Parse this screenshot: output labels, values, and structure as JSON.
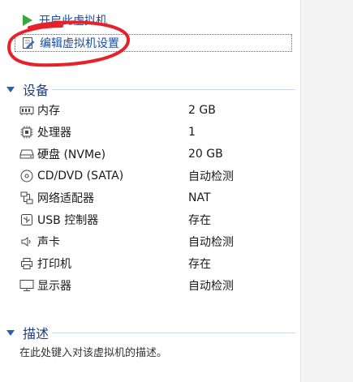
{
  "actions": {
    "power_on": "开启此虚拟机",
    "edit_settings": "编辑虚拟机设置"
  },
  "devices_section": {
    "title": "设备",
    "items": [
      {
        "name": "内存",
        "value": "2 GB",
        "icon": "memory-icon"
      },
      {
        "name": "处理器",
        "value": "1",
        "icon": "processor-icon"
      },
      {
        "name": "硬盘 (NVMe)",
        "value": "20 GB",
        "icon": "hard-disk-icon"
      },
      {
        "name": "CD/DVD (SATA)",
        "value": "自动检测",
        "icon": "cd-dvd-icon"
      },
      {
        "name": "网络适配器",
        "value": "NAT",
        "icon": "network-adapter-icon"
      },
      {
        "name": "USB 控制器",
        "value": "存在",
        "icon": "usb-icon"
      },
      {
        "name": "声卡",
        "value": "自动检测",
        "icon": "sound-card-icon"
      },
      {
        "name": "打印机",
        "value": "存在",
        "icon": "printer-icon"
      },
      {
        "name": "显示器",
        "value": "自动检测",
        "icon": "display-icon"
      }
    ]
  },
  "description_section": {
    "title": "描述",
    "placeholder": "在此处键入对该虚拟机的描述。"
  },
  "colors": {
    "link": "#1a4fa0",
    "section_title": "#1f3f86",
    "annotation": "#e8202a",
    "play": "#3aa83a"
  }
}
